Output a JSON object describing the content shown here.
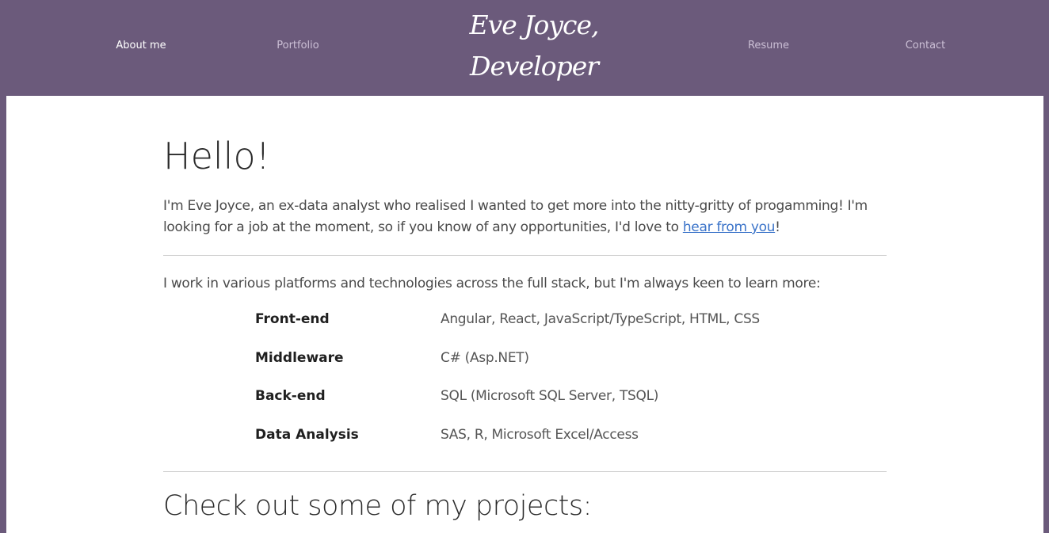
{
  "nav": {
    "about": "About me",
    "portfolio": "Portfolio",
    "resume": "Resume",
    "contact": "Contact"
  },
  "brand": {
    "line1": "Eve Joyce,",
    "line2": "Developer"
  },
  "main": {
    "heading": "Hello!",
    "intro_text": "I'm Eve Joyce, an ex-data analyst who realised I wanted to get more into the nitty-gritty of progamming! I'm looking for a job at the moment, so if you know of any opportunities, I'd love to ",
    "intro_link": "hear from you",
    "intro_end": "!",
    "platforms_text": "I work in various platforms and technologies across the full stack, but I'm always keen to learn more:",
    "skills": [
      {
        "name": "Front-end",
        "tech": "Angular, React, JavaScript/TypeScript, HTML, CSS"
      },
      {
        "name": "Middleware",
        "tech": "C# (Asp.NET)"
      },
      {
        "name": "Back-end",
        "tech": "SQL (Microsoft SQL Server, TSQL)"
      },
      {
        "name": "Data Analysis",
        "tech": "SAS, R, Microsoft Excel/Access"
      }
    ],
    "projects_heading": "Check out some of my projects:"
  },
  "colors": {
    "header_bg": "#6b5a7b",
    "link": "#3a73c9",
    "nav_inactive": "#cbbfd5",
    "nav_active": "#ffffff"
  }
}
